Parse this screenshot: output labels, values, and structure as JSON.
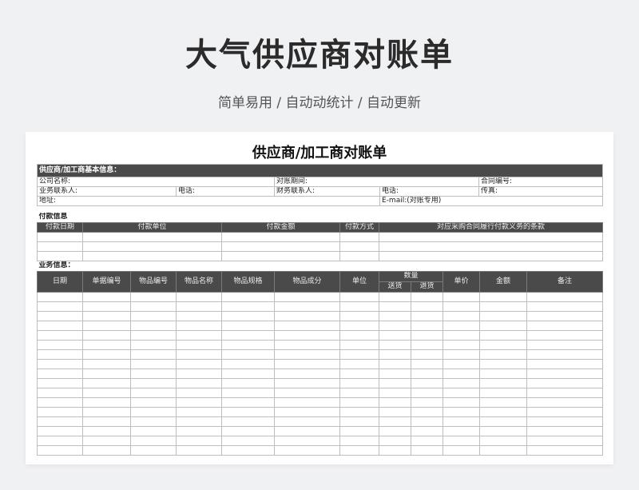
{
  "hero": {
    "title": "大气供应商对账单",
    "subtitle": "简单易用 / 自动动统计 / 自动更新"
  },
  "sheet": {
    "title": "供应商/加工商对账单",
    "basic": {
      "section_label": "供应商/加工商基本信息：",
      "company": "公司名称:",
      "period": "对账期间:",
      "contract_no": "合同编号:",
      "contact": "业务联系人:",
      "phone": "电话:",
      "finance_contact": "财务联系人:",
      "phone2": "电话:",
      "fax": "传真:",
      "address": "地址:",
      "email": "E-mail:(对账专用)"
    },
    "payment": {
      "section_label": "付款信息",
      "columns": [
        "付款日期",
        "付款单位",
        "付款金额",
        "付款方式",
        "对应采购合同履行付款义务的条款"
      ]
    },
    "business": {
      "section_label": "业务信息：",
      "columns": [
        "日期",
        "单据编号",
        "物品编号",
        "物品名称",
        "物品规格",
        "物品成分",
        "单位",
        "数量",
        "单价",
        "金额",
        "备注"
      ],
      "qty_sub": [
        "送货",
        "退货"
      ]
    }
  }
}
